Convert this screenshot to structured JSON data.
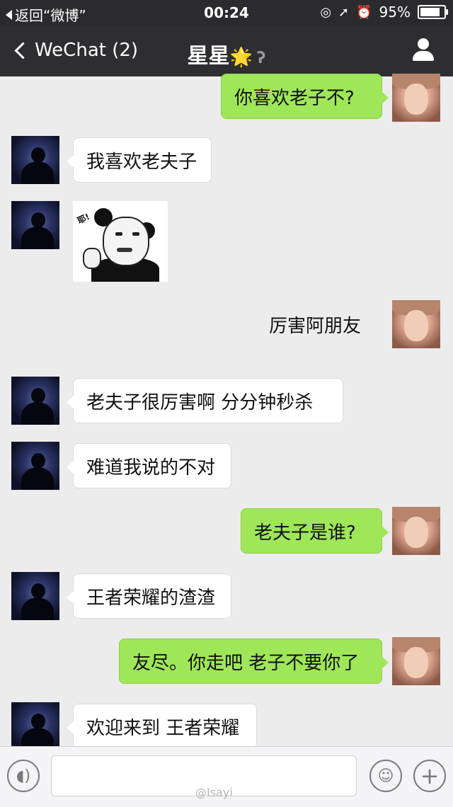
{
  "status_bar": {
    "back_label": "返回“微博”",
    "time": "00:24",
    "battery_percent": "95%",
    "battery_level": 0.95,
    "icons": [
      "lock-rotation-icon",
      "location-arrow-icon",
      "alarm-icon",
      "battery-icon"
    ]
  },
  "nav": {
    "back_label": "WeChat (2)",
    "title": "星星",
    "title_emoji": "🌟",
    "ear_icon": "ear-icon",
    "profile_icon": "person-icon"
  },
  "messages": [
    {
      "side": "right",
      "text": "你喜欢老子不?"
    },
    {
      "side": "left",
      "text": "我喜欢老夫子"
    },
    {
      "side": "left",
      "type": "sticker",
      "sticker_text": "耶!"
    },
    {
      "side": "right",
      "text": "厉害阿朋友"
    },
    {
      "side": "left",
      "text": "老夫子很厉害啊   分分钟秒杀"
    },
    {
      "side": "left",
      "text": "难道我说的不对"
    },
    {
      "side": "right",
      "text": "老夫子是谁?"
    },
    {
      "side": "left",
      "text": "王者荣耀的渣渣"
    },
    {
      "side": "right",
      "text": "友尽。你走吧 老子不要你了"
    },
    {
      "side": "left",
      "text": "欢迎来到 王者荣耀"
    }
  ],
  "input_bar": {
    "voice_icon": "voice-icon",
    "emoji_icon": "smiley-icon",
    "plus_icon": "plus-icon",
    "plus_glyph": "+",
    "watermark": "@Isayi"
  },
  "colors": {
    "status_bar_bg": "#2b2b2e",
    "nav_bg": "#2e2e30",
    "chat_bg": "#ececec",
    "bubble_green": "#9fe658",
    "bubble_white": "#ffffff"
  }
}
